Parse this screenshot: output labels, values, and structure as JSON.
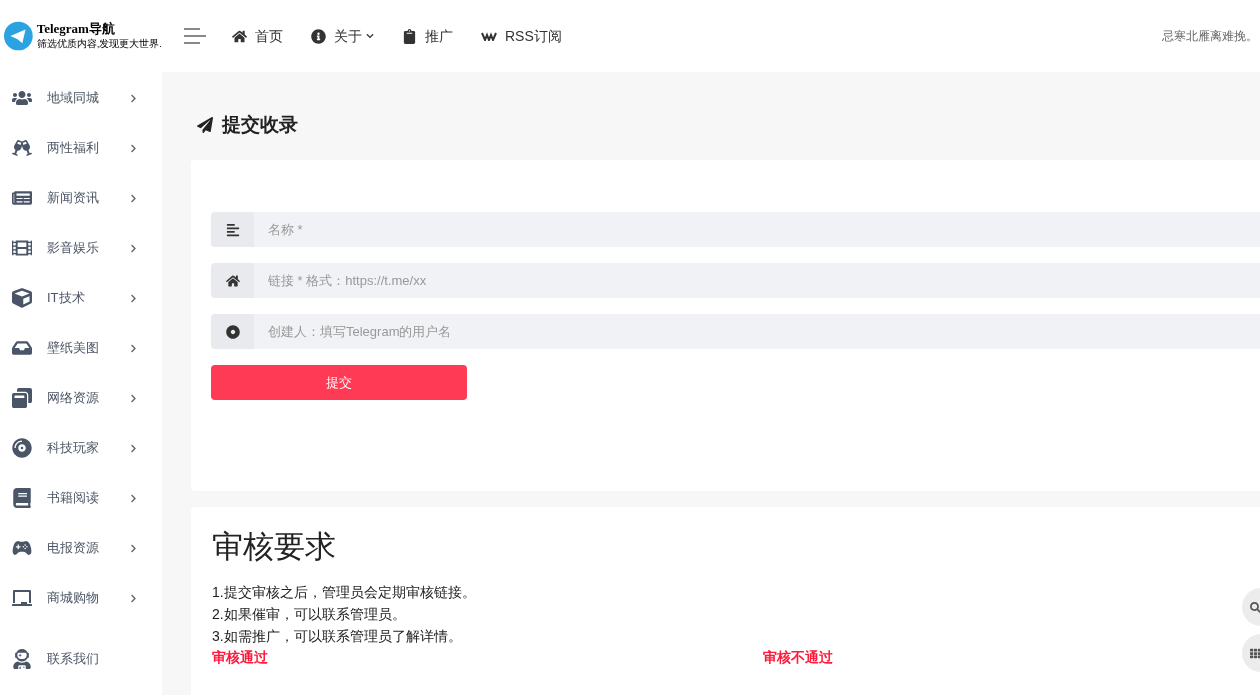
{
  "logo": {
    "title": "Telegram导航",
    "subtitle": "筛选优质内容,发现更大世界."
  },
  "nav": [
    {
      "label": "首页",
      "dropdown": false
    },
    {
      "label": "关于",
      "dropdown": true
    },
    {
      "label": "推广",
      "dropdown": false
    },
    {
      "label": "RSS订阅",
      "dropdown": false
    }
  ],
  "header_text": "忌寒北雁离难挽。",
  "sidebar": {
    "items": [
      {
        "label": "地域同城",
        "expandable": true
      },
      {
        "label": "两性福利",
        "expandable": true
      },
      {
        "label": "新闻资讯",
        "expandable": true
      },
      {
        "label": "影音娱乐",
        "expandable": true
      },
      {
        "label": "IT技术",
        "expandable": true
      },
      {
        "label": "壁纸美图",
        "expandable": true
      },
      {
        "label": "网络资源",
        "expandable": true
      },
      {
        "label": "科技玩家",
        "expandable": true
      },
      {
        "label": "书籍阅读",
        "expandable": true
      },
      {
        "label": "电报资源",
        "expandable": true
      },
      {
        "label": "商城购物",
        "expandable": true
      },
      {
        "label": "联系我们",
        "expandable": false
      }
    ]
  },
  "page_title": "提交收录",
  "form": {
    "fields": [
      {
        "placeholder": "名称 *"
      },
      {
        "placeholder": "链接 * 格式：https://t.me/xx"
      },
      {
        "placeholder": "创建人：填写Telegram的用户名"
      }
    ],
    "submit": "提交"
  },
  "requirements": {
    "title": "审核要求",
    "lines": [
      "1.提交审核之后，管理员会定期审核链接。",
      "2.如果催审，可以联系管理员。",
      "3.如需推广，可以联系管理员了解详情。"
    ],
    "columns": [
      "审核通过",
      "审核不通过"
    ]
  }
}
